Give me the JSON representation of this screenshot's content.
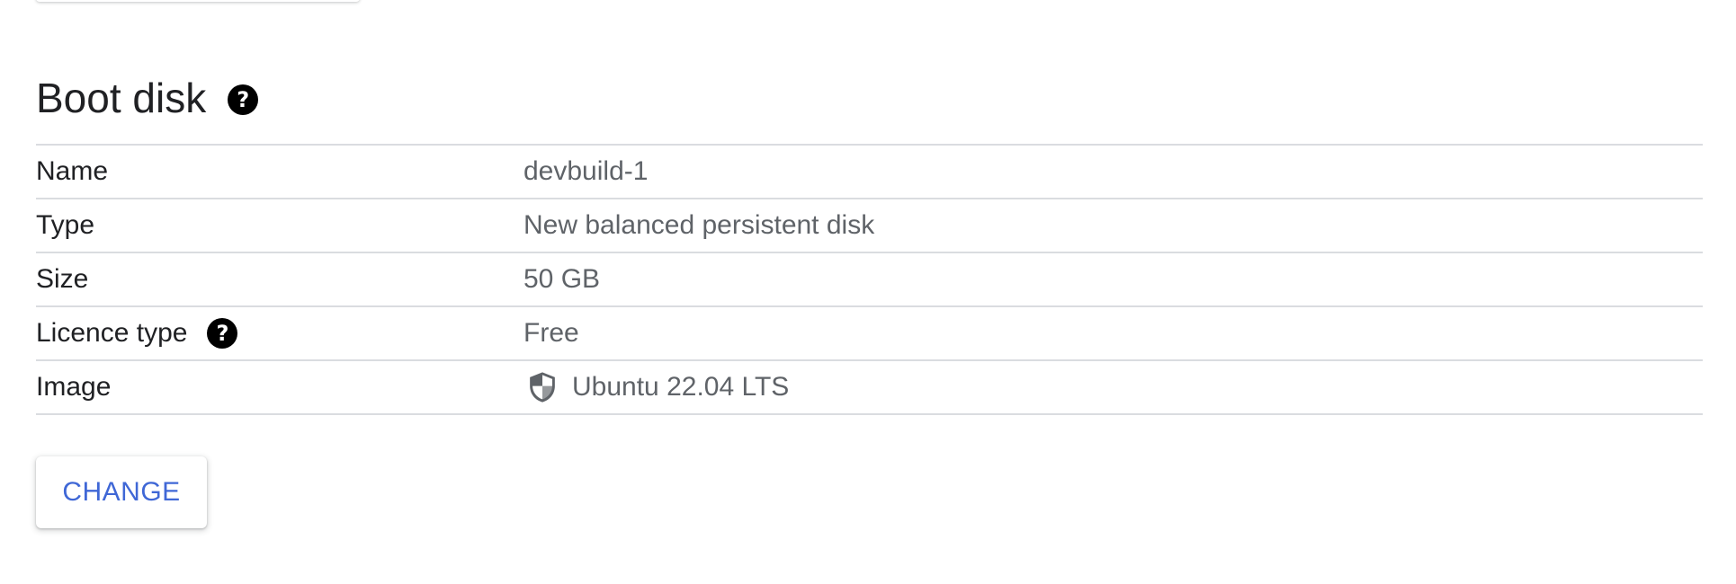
{
  "section": {
    "title": "Boot disk",
    "rows": [
      {
        "label": "Name",
        "value": "devbuild-1"
      },
      {
        "label": "Type",
        "value": "New balanced persistent disk"
      },
      {
        "label": "Size",
        "value": "50 GB"
      },
      {
        "label": "Licence type",
        "value": "Free"
      },
      {
        "label": "Image",
        "value": "Ubuntu 22.04 LTS"
      }
    ]
  },
  "icons": {
    "help": "?",
    "shield": "shield-icon"
  },
  "actions": {
    "change_label": "CHANGE"
  },
  "colors": {
    "accent": "#3f67d6",
    "divider": "#dadce0",
    "value_text": "#5f6368"
  }
}
